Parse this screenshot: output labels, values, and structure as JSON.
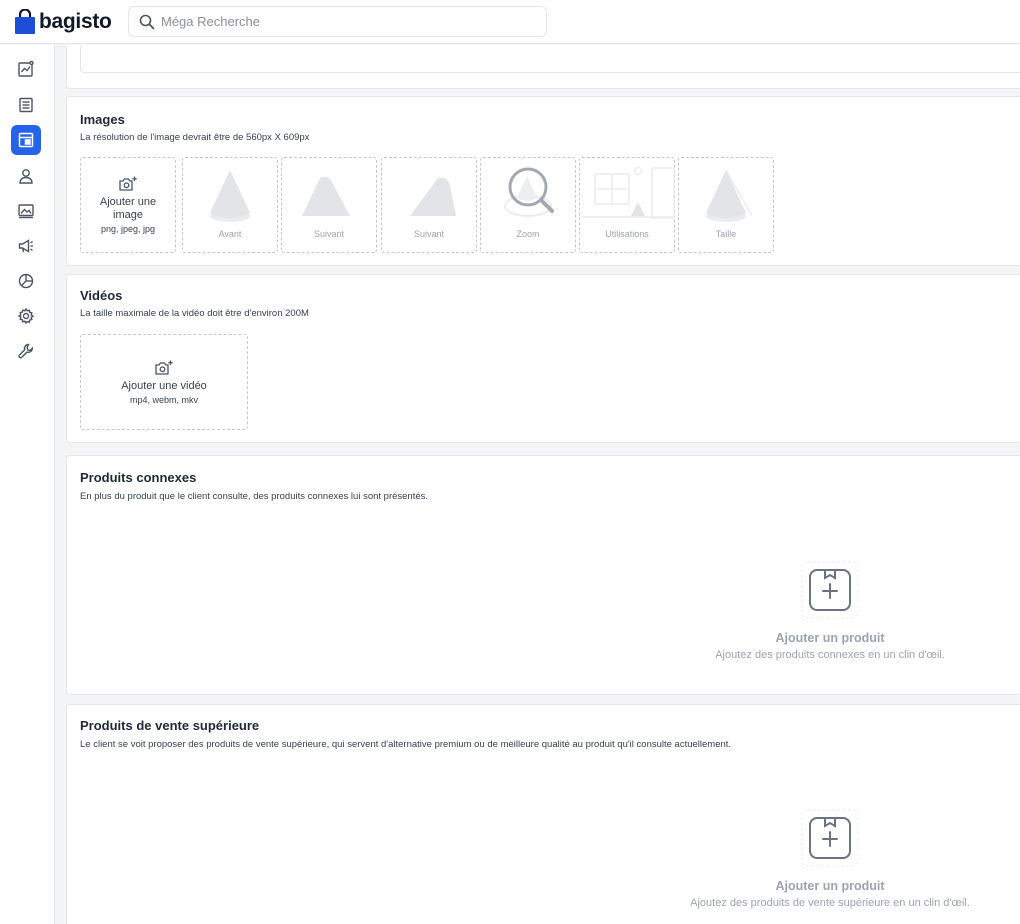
{
  "app": {
    "logo_text": "bagisto"
  },
  "search": {
    "placeholder": "Méga Recherche"
  },
  "sidebar": {
    "items": [
      {
        "name": "dashboard",
        "icon": "chart-icon"
      },
      {
        "name": "sales",
        "icon": "list-icon"
      },
      {
        "name": "catalog",
        "icon": "catalog-icon",
        "active": true
      },
      {
        "name": "customers",
        "icon": "user-icon"
      },
      {
        "name": "cms",
        "icon": "image-frame-icon"
      },
      {
        "name": "marketing",
        "icon": "megaphone-icon"
      },
      {
        "name": "reporting",
        "icon": "pie-icon"
      },
      {
        "name": "settings",
        "icon": "gear-icon"
      },
      {
        "name": "configure",
        "icon": "wrench-icon"
      }
    ]
  },
  "images": {
    "title": "Images",
    "description": "La résolution de l'image devrait être de 560px X 609px",
    "upload": {
      "label": "Ajouter une image",
      "formats": "png, jpeg, jpg"
    },
    "placeholders": [
      "Avant",
      "Suivant",
      "Suivant",
      "Zoom",
      "Utilisations",
      "Taille"
    ]
  },
  "videos": {
    "title": "Vidéos",
    "description": "La taille maximale de la vidéo doit être d'environ 200M",
    "upload": {
      "label": "Ajouter une vidéo",
      "formats": "mp4, webm, mkv"
    }
  },
  "related": {
    "title": "Produits connexes",
    "description": "En plus du produit que le client consulte, des produits connexes lui sont présentés.",
    "empty_title": "Ajouter un produit",
    "empty_sub": "Ajoutez des produits connexes en un clin d'œil."
  },
  "upsell": {
    "title": "Produits de vente supérieure",
    "description": "Le client se voit proposer des produits de vente supérieure, qui servent d'alternative premium ou de meilleure qualité au produit qu'il consulte actuellement.",
    "empty_title": "Ajouter un produit",
    "empty_sub": "Ajoutez des produits de vente supérieure en un clin d'œil."
  },
  "colors": {
    "accent": "#2563eb",
    "border": "#e5e7eb",
    "muted": "#9ca3af"
  }
}
